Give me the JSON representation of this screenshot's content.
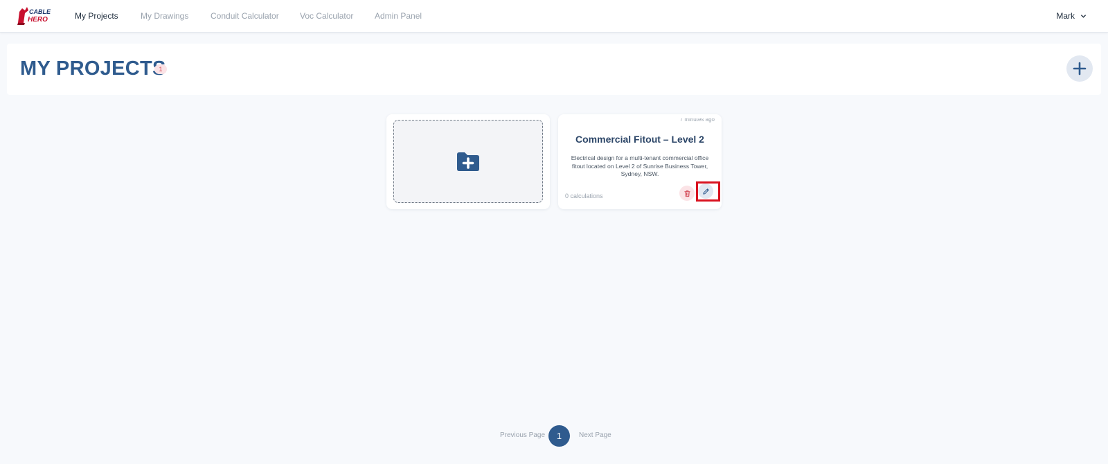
{
  "app": {
    "logo_text": "CABLE HERO"
  },
  "nav": {
    "items": [
      {
        "label": "My Projects",
        "active": true
      },
      {
        "label": "My Drawings",
        "active": false
      },
      {
        "label": "Conduit Calculator",
        "active": false
      },
      {
        "label": "Voc Calculator",
        "active": false
      },
      {
        "label": "Admin Panel",
        "active": false
      }
    ],
    "user": {
      "name": "Mark"
    }
  },
  "header": {
    "title": "MY PROJECTS",
    "count": "1"
  },
  "projects": [
    {
      "time": "7 minutes ago",
      "title": "Commercial Fitout – Level 2",
      "description": "Electrical design for a multi-tenant commercial office fitout located on Level 2 of Sunrise Business Tower, Sydney, NSW.",
      "calculations": "0 calculations"
    }
  ],
  "pagination": {
    "previous": "Previous Page",
    "current": "1",
    "next": "Next Page"
  },
  "colors": {
    "primary": "#2f5b8e",
    "highlight": "#d9121f",
    "badge_bg": "#fbe3e6",
    "badge_text": "#d44a58",
    "page_bg": "#f7f9fc"
  },
  "icons": {
    "logo": "cable-hero-logo",
    "user_menu": "chevron-down-icon",
    "add_project": "plus-icon",
    "new_project": "folder-plus-icon",
    "delete": "trash-icon",
    "edit": "pencil-icon"
  }
}
